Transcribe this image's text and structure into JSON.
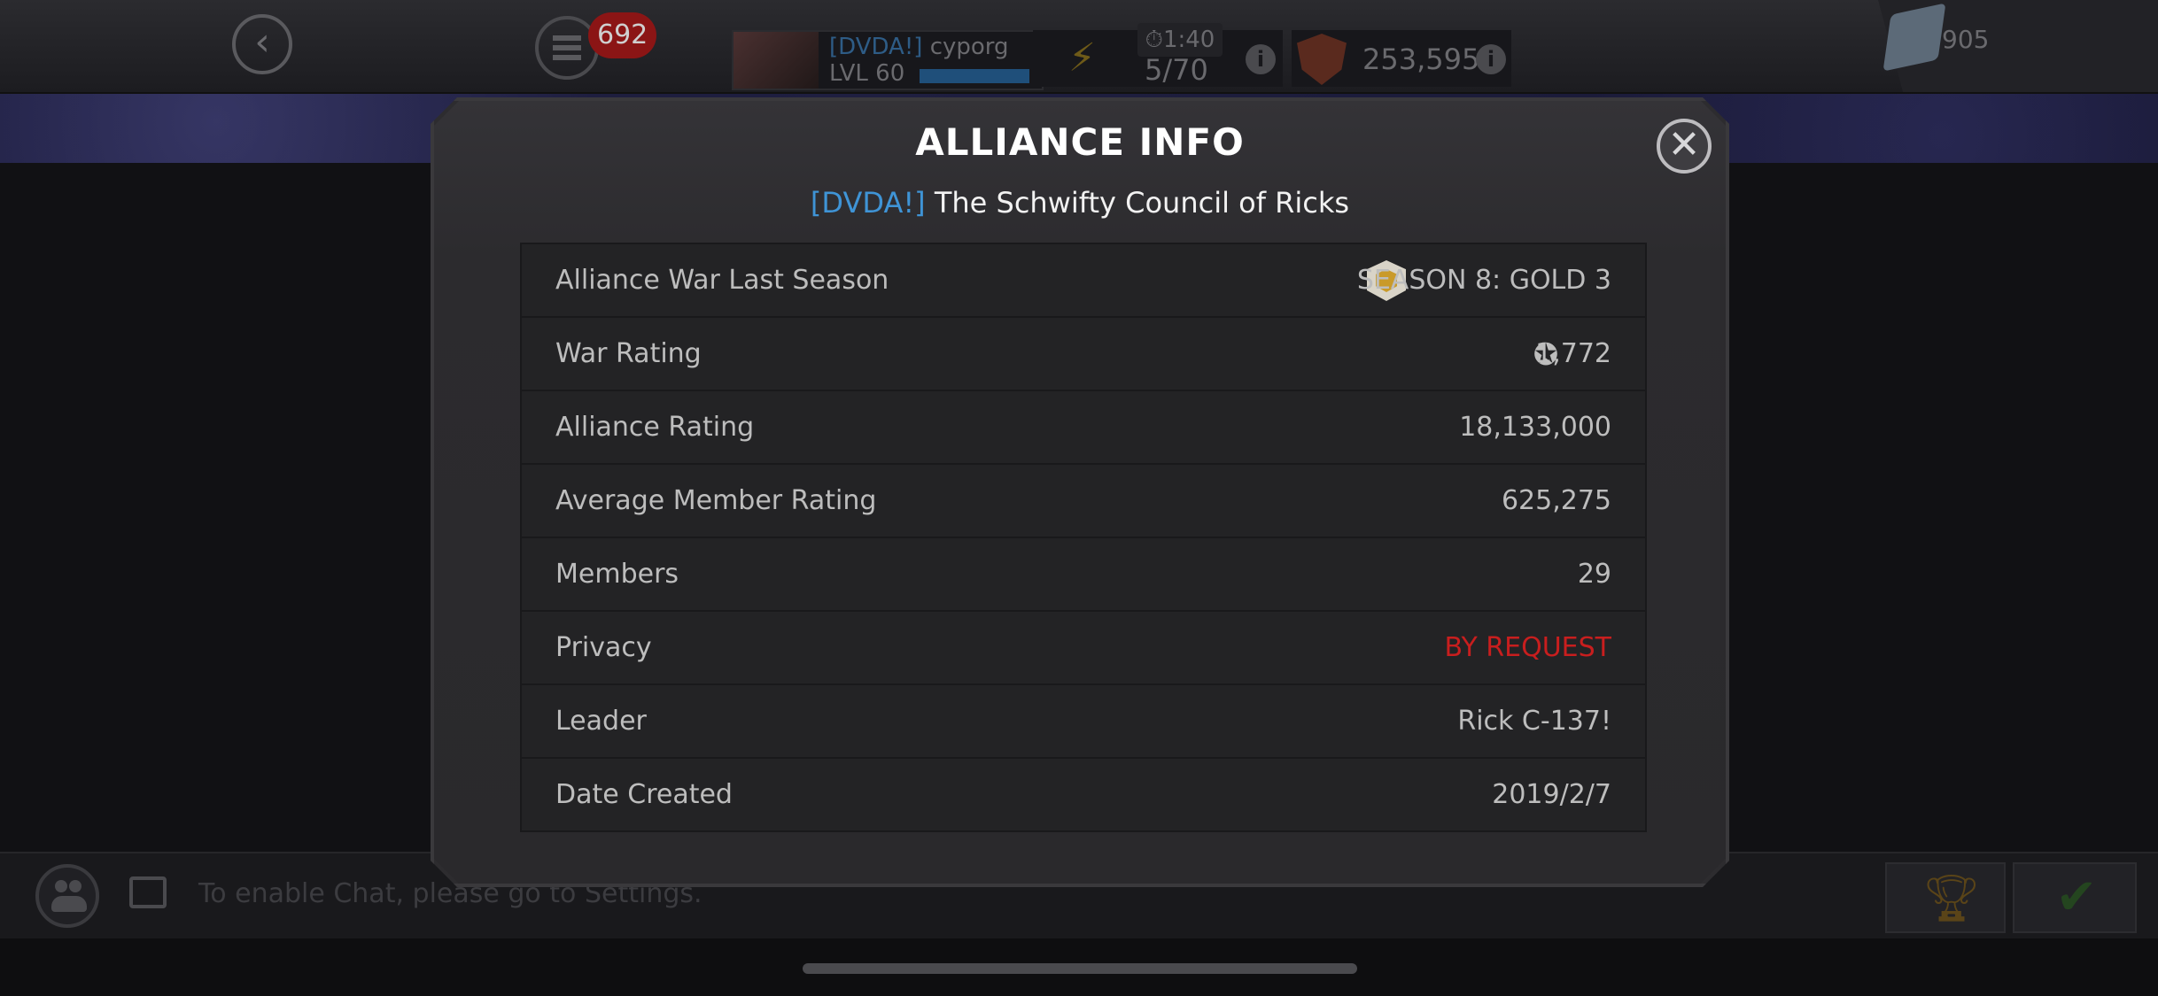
{
  "hud": {
    "notifications_count": "692",
    "profile_tag": "[DVDA!]",
    "profile_name": "cyporg",
    "level": "LVL 60",
    "energy_timer": "1:40",
    "energy": "5/70",
    "hero_rating": "253,595",
    "units": "905"
  },
  "chat": {
    "message": "To enable Chat, please go to Settings."
  },
  "modal": {
    "title": "ALLIANCE INFO",
    "alliance_tag": "[DVDA!]",
    "alliance_name": "The Schwifty Council of Ricks",
    "rows": [
      {
        "label": "Alliance War Last Season",
        "value": "SEASON 8: GOLD 3"
      },
      {
        "label": "War Rating",
        "value": "1,772"
      },
      {
        "label": "Alliance Rating",
        "value": "18,133,000"
      },
      {
        "label": "Average Member Rating",
        "value": "625,275"
      },
      {
        "label": "Members",
        "value": "29"
      },
      {
        "label": "Privacy",
        "value": "BY REQUEST"
      },
      {
        "label": "Leader",
        "value": "Rick C-137!"
      },
      {
        "label": "Date Created",
        "value": "2019/2/7"
      }
    ]
  },
  "colors": {
    "accent_blue": "#3f94d6",
    "privacy_red": "#c81e1e"
  },
  "icons": [
    "back-icon",
    "menu-icon",
    "bolt-icon",
    "timer-icon",
    "info-icon",
    "shield-icon",
    "gem-icon",
    "close-icon",
    "season-badge-icon",
    "war-star-icon",
    "people-icon",
    "chat-icon",
    "trophy-icon",
    "check-icon"
  ]
}
